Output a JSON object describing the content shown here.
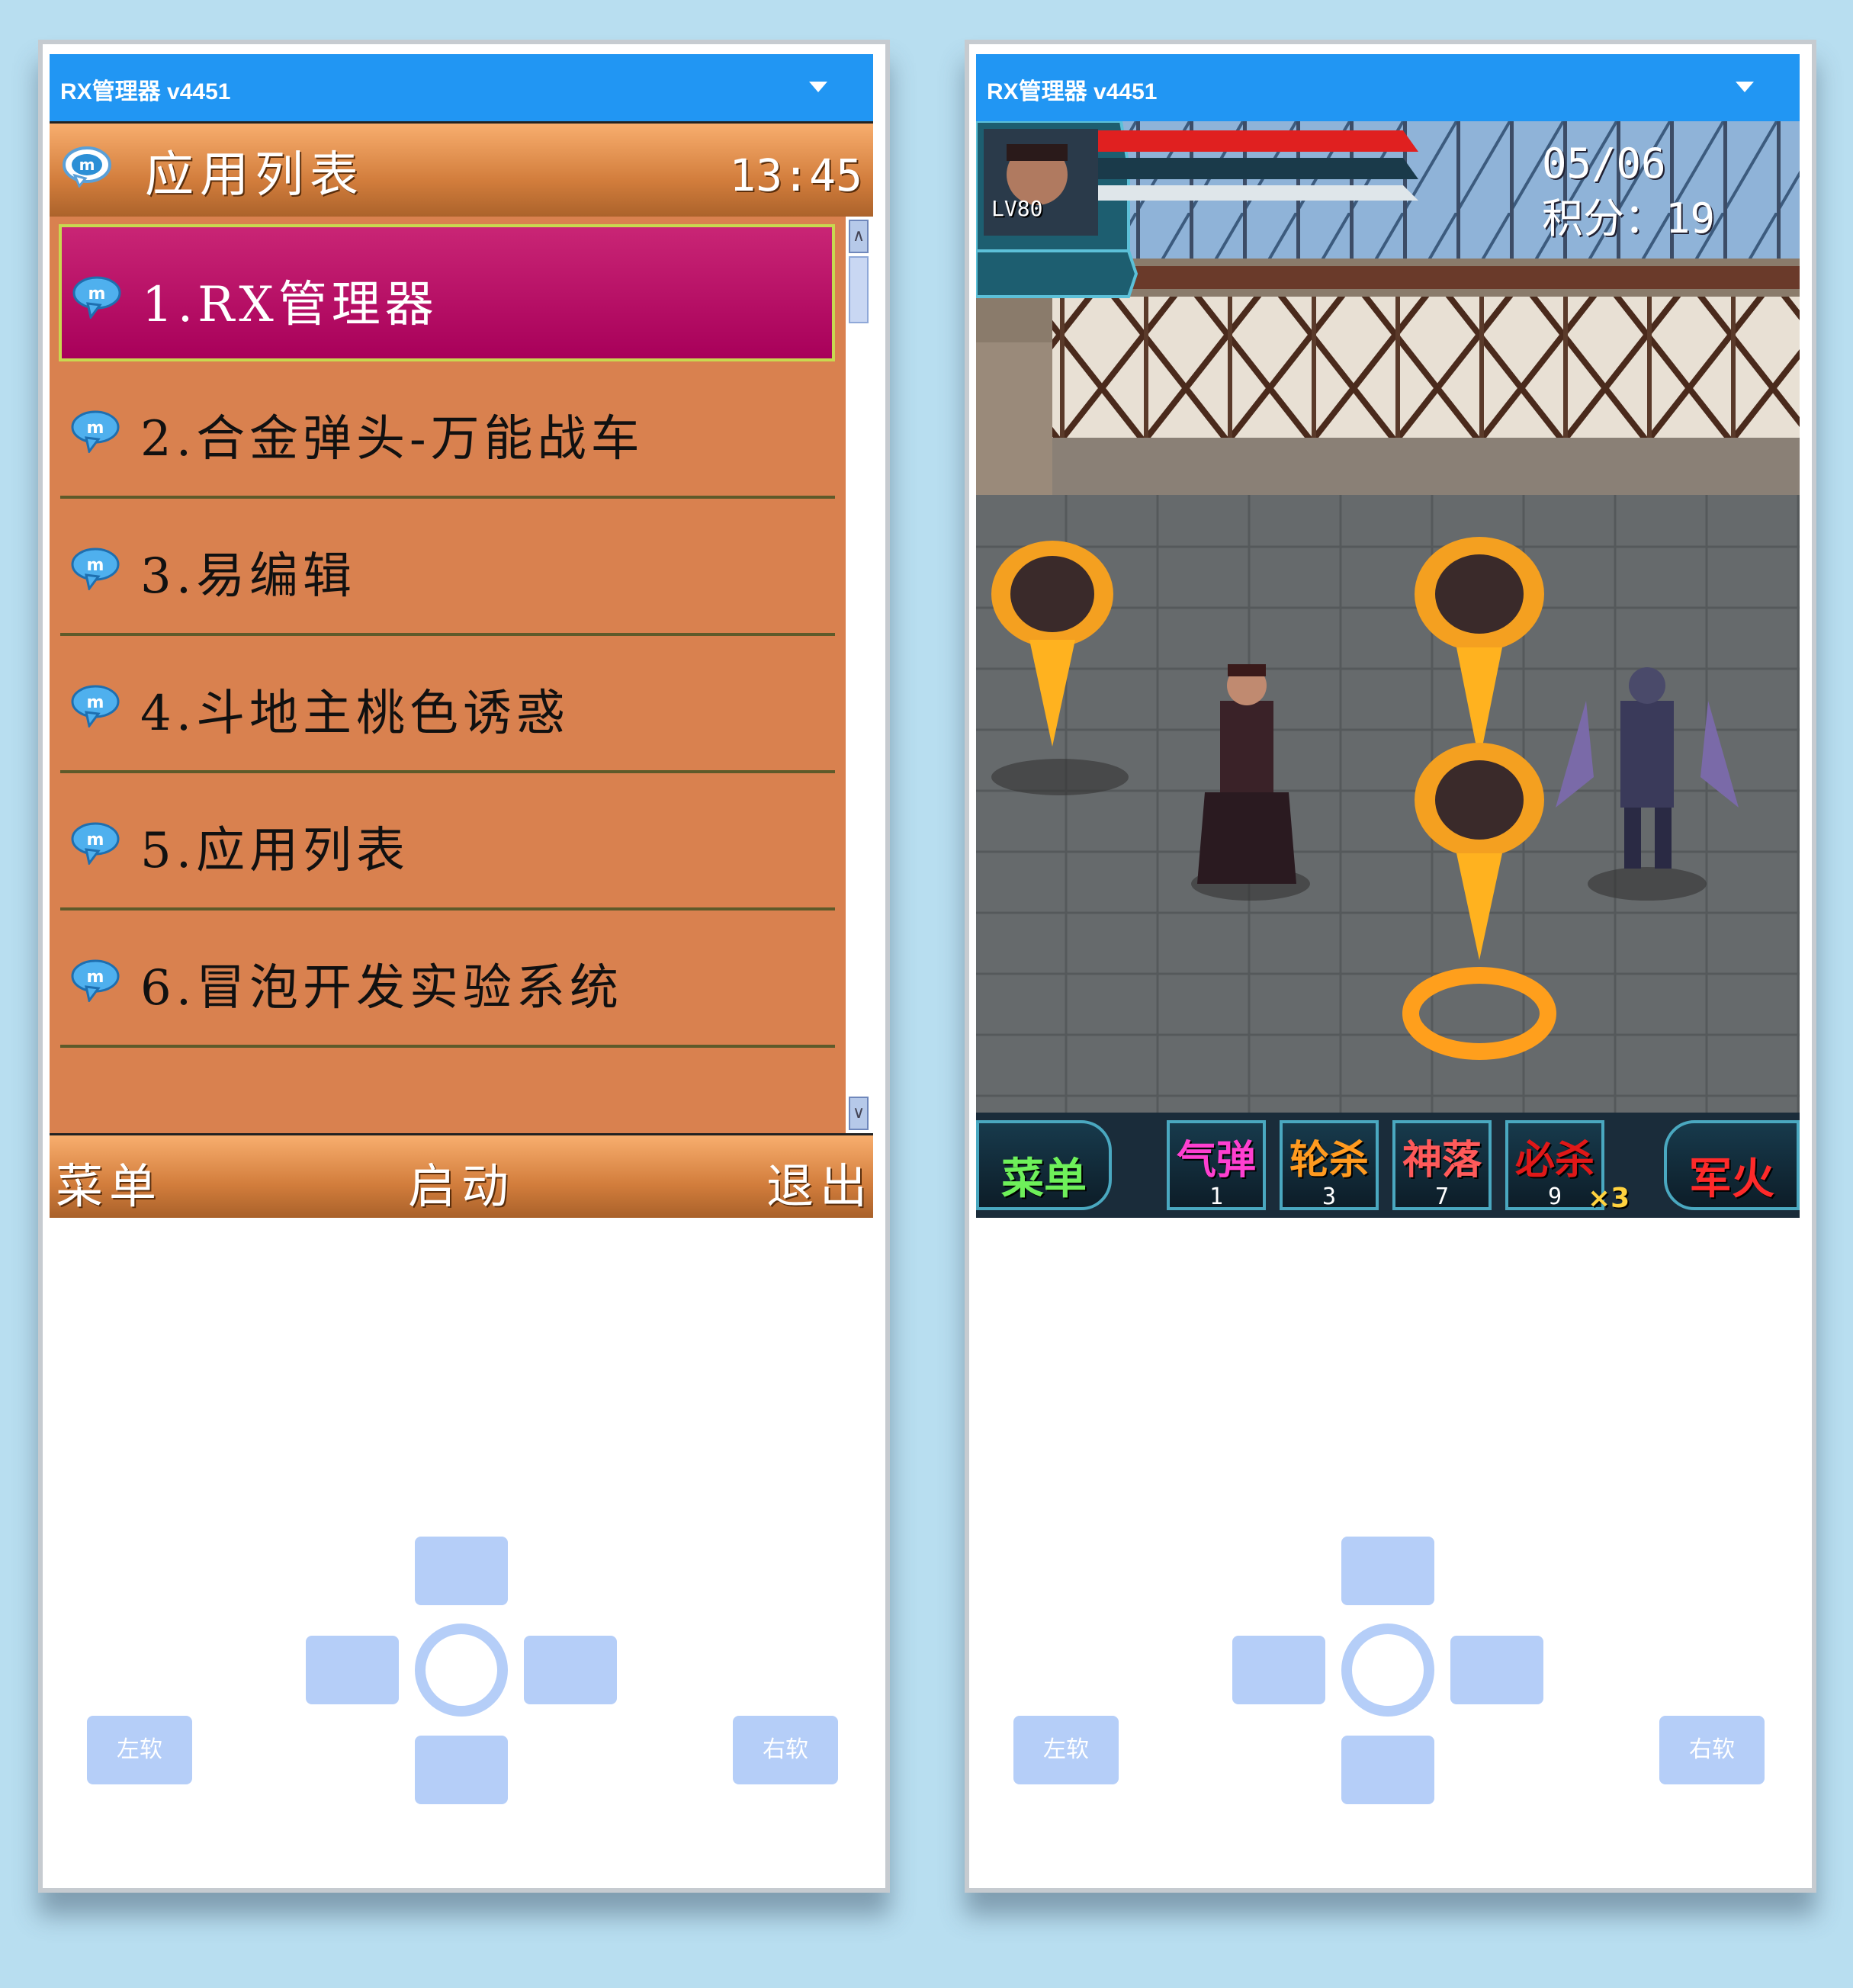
{
  "app_title": "RX管理器 v4451",
  "left_phone": {
    "header": {
      "title": "应用列表",
      "time": "13:45"
    },
    "list": [
      {
        "label": "1.RX管理器",
        "selected": true
      },
      {
        "label": "2.合金弹头-万能战车",
        "selected": false
      },
      {
        "label": "3.易编辑",
        "selected": false
      },
      {
        "label": "4.斗地主桃色诱惑",
        "selected": false
      },
      {
        "label": "5.应用列表",
        "selected": false
      },
      {
        "label": "6.冒泡开发实验系统",
        "selected": false
      }
    ],
    "scroll": {
      "up": "∧",
      "down": "∨"
    },
    "softkeys": {
      "left": "菜单",
      "center": "启动",
      "right": "退出"
    }
  },
  "right_phone": {
    "hud": {
      "level": "LV80",
      "stage": "05/06",
      "score_label": "积分：",
      "score_value": "19"
    },
    "bottom_bar": {
      "menu": "菜单",
      "skills": [
        {
          "name": "气弹",
          "key": "1",
          "color": "#ff3fd0"
        },
        {
          "name": "轮杀",
          "key": "3",
          "color": "#ff9a1f"
        },
        {
          "name": "神落",
          "key": "7",
          "color": "#ff5a5a"
        },
        {
          "name": "必杀",
          "key": "9",
          "color": "#e01818"
        }
      ],
      "multiplier": "×3",
      "fire": "军火"
    }
  },
  "keypad": {
    "left_soft": "左软",
    "right_soft": "右软"
  },
  "colors": {
    "background": "#b8def0",
    "topbar": "#2196f3",
    "header_orange": "#d27d3c",
    "list_bg": "#d9814f",
    "selected_item": "#b5005f",
    "keypad": "#b5cef8"
  }
}
